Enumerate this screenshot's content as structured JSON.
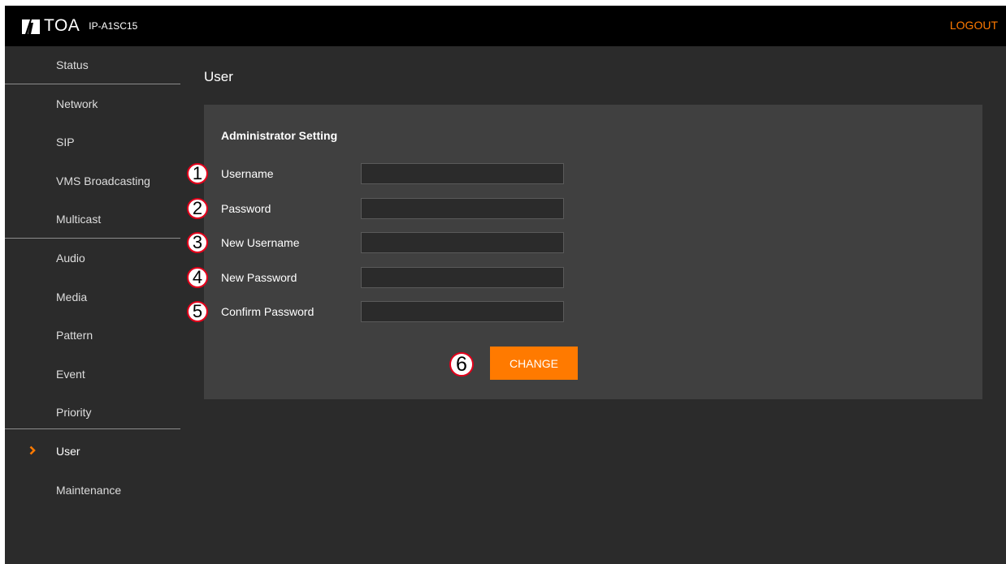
{
  "header": {
    "brand": "TOA",
    "model": "IP-A1SC15",
    "logout_label": "LOGOUT",
    "accent_color": "#ff7a00"
  },
  "sidebar": {
    "items": [
      {
        "label": "Status",
        "active": false
      },
      {
        "label": "Network",
        "active": false
      },
      {
        "label": "SIP",
        "active": false
      },
      {
        "label": "VMS Broadcasting",
        "active": false
      },
      {
        "label": "Multicast",
        "active": false
      },
      {
        "label": "Audio",
        "active": false
      },
      {
        "label": "Media",
        "active": false
      },
      {
        "label": "Pattern",
        "active": false
      },
      {
        "label": "Event",
        "active": false
      },
      {
        "label": "Priority",
        "active": false
      },
      {
        "label": "User",
        "active": true
      },
      {
        "label": "Maintenance",
        "active": false
      }
    ],
    "active_icon": "chevron-right-icon"
  },
  "main": {
    "title": "User",
    "section_title": "Administrator Setting",
    "fields": [
      {
        "marker": "1",
        "label": "Username",
        "value": ""
      },
      {
        "marker": "2",
        "label": "Password",
        "value": ""
      },
      {
        "marker": "3",
        "label": "New Username",
        "value": ""
      },
      {
        "marker": "4",
        "label": "New Password",
        "value": ""
      },
      {
        "marker": "5",
        "label": "Confirm Password",
        "value": ""
      }
    ],
    "change_marker": "6",
    "change_label": "CHANGE"
  }
}
